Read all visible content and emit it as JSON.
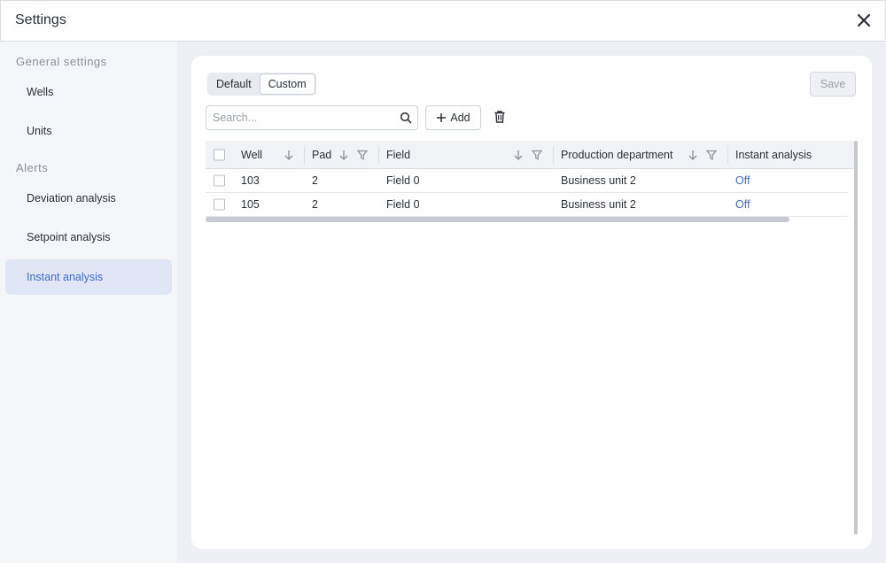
{
  "header": {
    "title": "Settings",
    "close_icon": "close-icon"
  },
  "sidebar": {
    "sections": [
      {
        "label": "General settings",
        "items": [
          "Wells",
          "Units"
        ]
      },
      {
        "label": "Alerts",
        "items": [
          "Deviation analysis",
          "Setpoint analysis",
          "Instant analysis"
        ]
      }
    ],
    "active_item": "Instant analysis"
  },
  "toolbar": {
    "mode_options": [
      "Default",
      "Custom"
    ],
    "active_mode": "Custom",
    "save_label": "Save",
    "search_placeholder": "Search...",
    "add_label": "Add"
  },
  "table": {
    "columns": [
      "Well",
      "Pad",
      "Field",
      "Production department",
      "Instant analysis"
    ],
    "rows": [
      {
        "well": "103",
        "pad": "2",
        "field": "Field 0",
        "department": "Business unit 2",
        "instant": "Off"
      },
      {
        "well": "105",
        "pad": "2",
        "field": "Field 0",
        "department": "Business unit 2",
        "instant": "Off"
      }
    ]
  },
  "colors": {
    "accent": "#3f6bc4",
    "active_bg": "#e1e6f7",
    "page_bg": "#eef0f6"
  }
}
